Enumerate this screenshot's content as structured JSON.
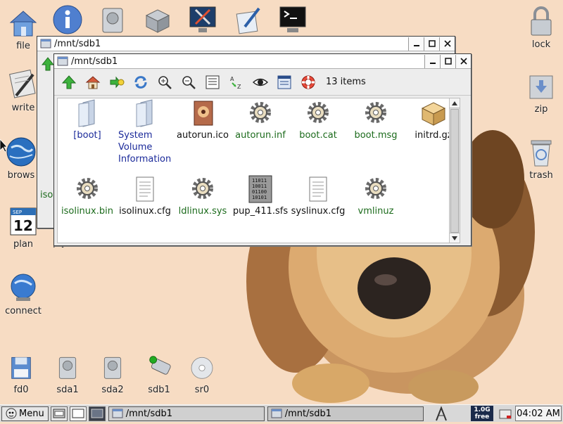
{
  "desktop": {
    "icons_left": [
      {
        "label": "file"
      },
      {
        "label": "write"
      },
      {
        "label": "brows"
      },
      {
        "label": "plan",
        "calendar_month": "SEP",
        "calendar_day": "12"
      },
      {
        "label": "connect"
      }
    ],
    "icons_right": [
      {
        "label": "lock"
      },
      {
        "label": "zip"
      },
      {
        "label": "trash"
      }
    ],
    "drives": [
      {
        "label": "fd0"
      },
      {
        "label": "sda1"
      },
      {
        "label": "sda2"
      },
      {
        "label": "sdb1"
      },
      {
        "label": "sr0"
      }
    ]
  },
  "back_window": {
    "title": "/mnt/sdb1",
    "peek_text_1": "isol",
    "peek_text_2": "ply"
  },
  "window": {
    "title": "/mnt/sdb1",
    "items_count": "13 items",
    "files": [
      {
        "name": "[boot]",
        "kind": "dir"
      },
      {
        "name": "System Volume Information",
        "kind": "dir"
      },
      {
        "name": "autorun.ico",
        "kind": "ico"
      },
      {
        "name": "autorun.inf",
        "kind": "exec"
      },
      {
        "name": "boot.cat",
        "kind": "exec"
      },
      {
        "name": "boot.msg",
        "kind": "exec"
      },
      {
        "name": "initrd.gz",
        "kind": "archive"
      },
      {
        "name": "isolinux.bin",
        "kind": "exec"
      },
      {
        "name": "isolinux.cfg",
        "kind": "text"
      },
      {
        "name": "ldlinux.sys",
        "kind": "exec"
      },
      {
        "name": "pup_411.sfs",
        "kind": "binary",
        "binary_lines": [
          "11011",
          "10011",
          "01100",
          "10101"
        ]
      },
      {
        "name": "syslinux.cfg",
        "kind": "text"
      },
      {
        "name": "vmlinuz",
        "kind": "exec"
      }
    ]
  },
  "taskbar": {
    "menu_label": "Menu",
    "tasks": [
      {
        "label": "/mnt/sdb1"
      },
      {
        "label": "/mnt/sdb1"
      }
    ],
    "free_size": "1.0G",
    "free_label": "free",
    "clock": "04:02 AM"
  },
  "colors": {
    "desktop_bg": "#f7dcc3",
    "dir_text": "#1b2a9a",
    "exec_text": "#1c6b1c"
  }
}
